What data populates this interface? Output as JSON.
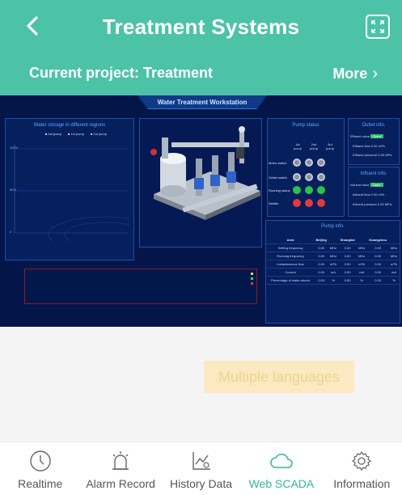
{
  "header": {
    "title": "Treatment Systems",
    "project_label": "Current project: Treatment",
    "more_label": "More",
    "more_chevron": "›"
  },
  "scada": {
    "workstation_title": "Water Treatment Workstation",
    "storage_panel_title": "Water storage in different regions",
    "legend": [
      "1st pump",
      "1st pump",
      "1st pump"
    ],
    "y_ticks": [
      "100%",
      "50%",
      "0"
    ],
    "pump_status_title": "Pump status",
    "pump_columns": [
      "1st pump",
      "2nd pump",
      "3rd pump"
    ],
    "pump_rows": [
      "Motor switch",
      "Outlet switch",
      "Running status",
      "Details"
    ],
    "outlet_title": "Outlet info.",
    "outlet_valve_label": "Effluent valve",
    "outlet_valve_value": "Open",
    "outlet_flow_label": "Effluent flow",
    "outlet_flow_value": "0.00",
    "outlet_flow_unit": "m³/h",
    "outlet_pressure_label": "Effluent pressure",
    "outlet_pressure_value": "0.00",
    "outlet_pressure_unit": "MPa",
    "influent_title": "Influent info.",
    "influent_valve_label": "Influent valve",
    "influent_valve_value": "Open",
    "influent_flow_label": "Influent flow",
    "influent_flow_value": "0.00",
    "influent_flow_unit": "m³/h",
    "influent_pressure_label": "Influent pressure",
    "influent_pressure_value": "0.00",
    "influent_pressure_unit": "MPa",
    "pump_info_title": "Pump info.",
    "table_headers": [
      "Area",
      "Beijing",
      "",
      "Shanghai",
      "",
      "Guangzhou",
      ""
    ],
    "table_rows": [
      [
        "Setting frequency",
        "0.00",
        "MHz",
        "0.00",
        "MHz",
        "0.00",
        "MHz"
      ],
      [
        "Running frequency",
        "0.00",
        "MHz",
        "0.00",
        "MHz",
        "0.00",
        "MHz"
      ],
      [
        "Instantaneous flow",
        "0.00",
        "m³/h",
        "0.00",
        "m³/h",
        "0.00",
        "m³/h"
      ],
      [
        "Current",
        "0.00",
        "mA",
        "0.00",
        "mA",
        "0.00",
        "mA"
      ],
      [
        "Percentage of water stored",
        "0.00",
        "%",
        "0.00",
        "%",
        "0.00",
        "%"
      ]
    ],
    "colors": {
      "background": "#04154a",
      "panel_border": "#1b4fa8",
      "open": "#33c46a"
    }
  },
  "language_button": "Multiple languages",
  "tabs": [
    {
      "label": "Realtime",
      "icon": "clock-icon",
      "active": false
    },
    {
      "label": "Alarm Record",
      "icon": "alarm-icon",
      "active": false
    },
    {
      "label": "History Data",
      "icon": "chart-icon",
      "active": false
    },
    {
      "label": "Web SCADA",
      "icon": "cloud-icon",
      "active": true
    },
    {
      "label": "Information",
      "icon": "gear-icon",
      "active": false
    }
  ],
  "accent_color": "#4cc3a7",
  "active_tab_color": "#33b894"
}
